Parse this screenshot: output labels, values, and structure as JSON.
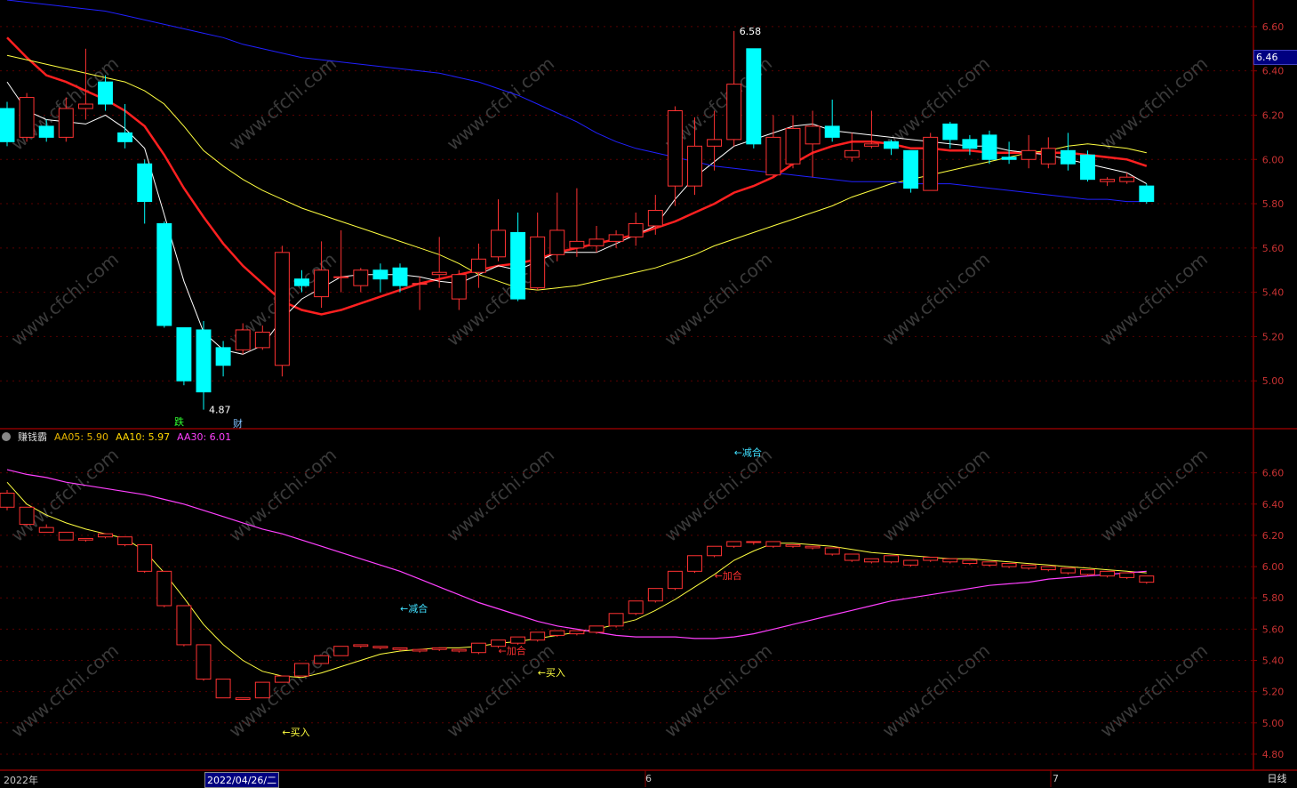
{
  "chart_data": [
    {
      "type": "candlestick",
      "panel": "main",
      "ylim": [
        4.8,
        6.7
      ],
      "y_ticks": [
        "6.60",
        "6.40",
        "6.20",
        "6.00",
        "5.80",
        "5.60",
        "5.40",
        "5.20",
        "5.00"
      ],
      "current_price": "6.46",
      "annotations": {
        "high": "6.58",
        "low": "4.87",
        "marker_down": "跌",
        "marker_fin": "财"
      },
      "candles": [
        [
          6.23,
          6.08,
          6.26,
          6.06
        ],
        [
          6.1,
          6.28,
          6.3,
          6.08
        ],
        [
          6.15,
          6.1,
          6.18,
          6.08
        ],
        [
          6.1,
          6.23,
          6.28,
          6.08
        ],
        [
          6.23,
          6.25,
          6.5,
          6.18
        ],
        [
          6.35,
          6.25,
          6.38,
          6.22
        ],
        [
          6.12,
          6.08,
          6.25,
          6.05
        ],
        [
          5.98,
          5.81,
          6.0,
          5.71
        ],
        [
          5.71,
          5.25,
          5.72,
          5.24
        ],
        [
          5.24,
          5.0,
          5.24,
          4.98
        ],
        [
          5.23,
          4.95,
          5.27,
          4.87
        ],
        [
          5.15,
          5.07,
          5.18,
          5.02
        ],
        [
          5.14,
          5.23,
          5.26,
          5.12
        ],
        [
          5.15,
          5.22,
          5.25,
          5.14
        ],
        [
          5.07,
          5.58,
          5.61,
          5.02
        ],
        [
          5.46,
          5.43,
          5.5,
          5.4
        ],
        [
          5.38,
          5.5,
          5.63,
          5.33
        ],
        [
          5.47,
          5.47,
          5.68,
          5.4
        ],
        [
          5.43,
          5.5,
          5.51,
          5.4
        ],
        [
          5.5,
          5.46,
          5.53,
          5.4
        ],
        [
          5.51,
          5.43,
          5.53,
          5.4
        ],
        [
          5.44,
          5.44,
          5.47,
          5.32
        ],
        [
          5.48,
          5.49,
          5.65,
          5.42
        ],
        [
          5.37,
          5.48,
          5.5,
          5.32
        ],
        [
          5.49,
          5.55,
          5.62,
          5.42
        ],
        [
          5.56,
          5.68,
          5.82,
          5.54
        ],
        [
          5.67,
          5.37,
          5.76,
          5.36
        ],
        [
          5.42,
          5.65,
          5.76,
          5.41
        ],
        [
          5.57,
          5.68,
          5.85,
          5.54
        ],
        [
          5.6,
          5.63,
          5.87,
          5.56
        ],
        [
          5.61,
          5.64,
          5.7,
          5.58
        ],
        [
          5.63,
          5.66,
          5.68,
          5.6
        ],
        [
          5.65,
          5.71,
          5.76,
          5.61
        ],
        [
          5.7,
          5.77,
          5.84,
          5.66
        ],
        [
          5.88,
          6.22,
          6.24,
          5.79
        ],
        [
          5.88,
          6.06,
          6.19,
          5.84
        ],
        [
          6.06,
          6.09,
          6.22,
          5.95
        ],
        [
          6.09,
          6.34,
          6.58,
          6.06
        ],
        [
          6.5,
          6.07,
          6.5,
          6.05
        ],
        [
          5.93,
          6.1,
          6.2,
          5.92
        ],
        [
          5.98,
          6.14,
          6.2,
          5.96
        ],
        [
          6.07,
          6.15,
          6.22,
          5.92
        ],
        [
          6.15,
          6.1,
          6.27,
          6.08
        ],
        [
          6.01,
          6.04,
          6.12,
          5.99
        ],
        [
          6.06,
          6.07,
          6.22,
          6.05
        ],
        [
          6.08,
          6.05,
          6.09,
          6.02
        ],
        [
          6.04,
          5.87,
          6.04,
          5.85
        ],
        [
          5.86,
          6.1,
          6.12,
          5.86
        ],
        [
          6.16,
          6.09,
          6.17,
          6.05
        ],
        [
          6.09,
          6.05,
          6.11,
          6.02
        ],
        [
          6.11,
          6.0,
          6.13,
          5.98
        ],
        [
          6.01,
          6.0,
          6.08,
          5.98
        ],
        [
          6.0,
          6.04,
          6.11,
          5.96
        ],
        [
          5.98,
          6.05,
          6.1,
          5.96
        ],
        [
          6.04,
          5.98,
          6.12,
          5.95
        ],
        [
          6.02,
          5.91,
          6.04,
          5.9
        ],
        [
          5.9,
          5.91,
          5.92,
          5.88
        ],
        [
          5.9,
          5.92,
          5.94,
          5.89
        ],
        [
          5.88,
          5.81,
          5.89,
          5.8
        ]
      ],
      "series": [
        {
          "color": "#ff2020",
          "width": 2.5,
          "values": [
            6.55,
            6.46,
            6.38,
            6.35,
            6.31,
            6.27,
            6.22,
            6.15,
            6.02,
            5.87,
            5.74,
            5.62,
            5.52,
            5.44,
            5.36,
            5.32,
            5.3,
            5.32,
            5.35,
            5.38,
            5.41,
            5.44,
            5.46,
            5.48,
            5.5,
            5.52,
            5.53,
            5.55,
            5.58,
            5.6,
            5.62,
            5.64,
            5.66,
            5.69,
            5.72,
            5.76,
            5.8,
            5.85,
            5.88,
            5.92,
            5.98,
            6.03,
            6.06,
            6.08,
            6.08,
            6.07,
            6.05,
            6.05,
            6.04,
            6.04,
            6.03,
            6.03,
            6.03,
            6.03,
            6.03,
            6.02,
            6.01,
            6.0,
            5.97
          ]
        },
        {
          "color": "#ffffff",
          "width": 1,
          "values": [
            6.35,
            6.22,
            6.18,
            6.17,
            6.16,
            6.2,
            6.14,
            6.05,
            5.75,
            5.45,
            5.22,
            5.14,
            5.12,
            5.16,
            5.28,
            5.37,
            5.42,
            5.47,
            5.48,
            5.48,
            5.48,
            5.47,
            5.45,
            5.44,
            5.48,
            5.52,
            5.5,
            5.54,
            5.58,
            5.58,
            5.58,
            5.62,
            5.66,
            5.7,
            5.82,
            5.92,
            5.99,
            6.06,
            6.09,
            6.12,
            6.15,
            6.16,
            6.13,
            6.12,
            6.11,
            6.1,
            6.09,
            6.08,
            6.07,
            6.06,
            6.06,
            6.04,
            6.03,
            6.02,
            6.0,
            5.98,
            5.96,
            5.94,
            5.89
          ]
        },
        {
          "color": "#ffff40",
          "width": 1,
          "values": [
            6.47,
            6.45,
            6.43,
            6.41,
            6.39,
            6.37,
            6.35,
            6.31,
            6.25,
            6.15,
            6.04,
            5.97,
            5.91,
            5.86,
            5.82,
            5.78,
            5.75,
            5.72,
            5.69,
            5.66,
            5.63,
            5.6,
            5.57,
            5.53,
            5.48,
            5.45,
            5.42,
            5.41,
            5.42,
            5.43,
            5.45,
            5.47,
            5.49,
            5.51,
            5.54,
            5.57,
            5.61,
            5.64,
            5.67,
            5.7,
            5.73,
            5.76,
            5.79,
            5.83,
            5.86,
            5.89,
            5.91,
            5.93,
            5.95,
            5.97,
            5.99,
            6.01,
            6.03,
            6.04,
            6.06,
            6.07,
            6.06,
            6.05,
            6.03
          ]
        },
        {
          "color": "#2020ff",
          "width": 1,
          "values": [
            6.72,
            6.71,
            6.7,
            6.69,
            6.68,
            6.67,
            6.65,
            6.63,
            6.61,
            6.59,
            6.57,
            6.55,
            6.52,
            6.5,
            6.48,
            6.46,
            6.45,
            6.44,
            6.43,
            6.42,
            6.41,
            6.4,
            6.39,
            6.37,
            6.35,
            6.32,
            6.29,
            6.25,
            6.21,
            6.17,
            6.12,
            6.08,
            6.05,
            6.03,
            6.01,
            5.99,
            5.97,
            5.96,
            5.95,
            5.94,
            5.93,
            5.92,
            5.91,
            5.9,
            5.9,
            5.9,
            5.89,
            5.89,
            5.89,
            5.88,
            5.87,
            5.86,
            5.85,
            5.84,
            5.83,
            5.82,
            5.82,
            5.81,
            5.81
          ]
        }
      ]
    },
    {
      "type": "candlestick",
      "panel": "indicator",
      "name": "赚钱霸",
      "legend": [
        {
          "label": "AA05: 5.90",
          "color": "#e6b400"
        },
        {
          "label": "AA10: 5.97",
          "color": "#ffd700"
        },
        {
          "label": "AA30: 6.01",
          "color": "#ff40ff"
        }
      ],
      "ylim": [
        4.72,
        6.78
      ],
      "y_ticks": [
        "6.60",
        "6.40",
        "6.20",
        "6.00",
        "5.80",
        "5.60",
        "5.40",
        "5.20",
        "5.00",
        "4.80"
      ],
      "annotations": [
        {
          "text": "←减合",
          "x_index": 37,
          "y": 6.71,
          "color": "#40e0ff"
        },
        {
          "text": "←减合",
          "x_index": 20,
          "y": 5.71,
          "color": "#40e0ff"
        },
        {
          "text": "←加合",
          "x_index": 25,
          "y": 5.44,
          "color": "#ff3030"
        },
        {
          "text": "←加合",
          "x_index": 36,
          "y": 5.92,
          "color": "#ff3030"
        },
        {
          "text": "←买入",
          "x_index": 27,
          "y": 5.3,
          "color": "#ffff40"
        },
        {
          "text": "←买入",
          "x_index": 14,
          "y": 4.92,
          "color": "#ffff40"
        }
      ],
      "candles": [
        [
          6.38,
          6.47,
          6.49,
          6.36
        ],
        [
          6.27,
          6.38,
          6.38,
          6.26
        ],
        [
          6.22,
          6.25,
          6.27,
          6.22
        ],
        [
          6.17,
          6.22,
          6.22,
          6.17
        ],
        [
          6.17,
          6.18,
          6.18,
          6.16
        ],
        [
          6.19,
          6.21,
          6.21,
          6.18
        ],
        [
          6.14,
          6.19,
          6.19,
          6.13
        ],
        [
          5.97,
          6.14,
          6.14,
          5.96
        ],
        [
          5.75,
          5.97,
          5.97,
          5.74
        ],
        [
          5.5,
          5.75,
          5.75,
          5.49
        ],
        [
          5.28,
          5.5,
          5.5,
          5.27
        ],
        [
          5.16,
          5.28,
          5.28,
          5.16
        ],
        [
          5.15,
          5.16,
          5.16,
          5.15
        ],
        [
          5.16,
          5.26,
          5.26,
          5.16
        ],
        [
          5.26,
          5.3,
          5.3,
          5.26
        ],
        [
          5.3,
          5.38,
          5.38,
          5.3
        ],
        [
          5.38,
          5.43,
          5.43,
          5.38
        ],
        [
          5.43,
          5.49,
          5.49,
          5.43
        ],
        [
          5.49,
          5.5,
          5.5,
          5.48
        ],
        [
          5.48,
          5.49,
          5.49,
          5.47
        ],
        [
          5.47,
          5.48,
          5.48,
          5.46
        ],
        [
          5.46,
          5.47,
          5.47,
          5.45
        ],
        [
          5.47,
          5.48,
          5.48,
          5.46
        ],
        [
          5.46,
          5.47,
          5.47,
          5.45
        ],
        [
          5.45,
          5.51,
          5.51,
          5.44
        ],
        [
          5.49,
          5.53,
          5.53,
          5.48
        ],
        [
          5.51,
          5.55,
          5.55,
          5.5
        ],
        [
          5.53,
          5.58,
          5.58,
          5.52
        ],
        [
          5.56,
          5.59,
          5.59,
          5.55
        ],
        [
          5.57,
          5.59,
          5.59,
          5.56
        ],
        [
          5.58,
          5.62,
          5.62,
          5.57
        ],
        [
          5.62,
          5.7,
          5.7,
          5.61
        ],
        [
          5.7,
          5.78,
          5.78,
          5.69
        ],
        [
          5.78,
          5.86,
          5.86,
          5.77
        ],
        [
          5.86,
          5.97,
          5.97,
          5.85
        ],
        [
          5.97,
          6.07,
          6.07,
          5.96
        ],
        [
          6.07,
          6.13,
          6.13,
          6.06
        ],
        [
          6.13,
          6.16,
          6.16,
          6.12
        ],
        [
          6.16,
          6.16,
          6.16,
          6.14
        ],
        [
          6.13,
          6.16,
          6.16,
          6.12
        ],
        [
          6.13,
          6.14,
          6.14,
          6.12
        ],
        [
          6.12,
          6.13,
          6.13,
          6.11
        ],
        [
          6.08,
          6.12,
          6.12,
          6.07
        ],
        [
          6.04,
          6.08,
          6.08,
          6.03
        ],
        [
          6.03,
          6.05,
          6.05,
          6.02
        ],
        [
          6.03,
          6.07,
          6.07,
          6.02
        ],
        [
          6.01,
          6.04,
          6.04,
          6.0
        ],
        [
          6.04,
          6.06,
          6.06,
          6.03
        ],
        [
          6.03,
          6.05,
          6.05,
          6.02
        ],
        [
          6.02,
          6.04,
          6.04,
          6.01
        ],
        [
          6.01,
          6.03,
          6.03,
          6.0
        ],
        [
          6.0,
          6.02,
          6.02,
          5.99
        ],
        [
          5.99,
          6.01,
          6.01,
          5.98
        ],
        [
          5.98,
          6.0,
          6.0,
          5.97
        ],
        [
          5.96,
          5.99,
          5.99,
          5.95
        ],
        [
          5.95,
          5.98,
          5.98,
          5.94
        ],
        [
          5.94,
          5.97,
          5.97,
          5.93
        ],
        [
          5.93,
          5.96,
          5.96,
          5.92
        ],
        [
          5.9,
          5.94,
          5.94,
          5.89
        ]
      ],
      "series": [
        {
          "color": "#ffff40",
          "width": 1,
          "values": [
            6.54,
            6.4,
            6.33,
            6.28,
            6.24,
            6.21,
            6.18,
            6.1,
            5.96,
            5.8,
            5.63,
            5.5,
            5.4,
            5.33,
            5.3,
            5.29,
            5.32,
            5.36,
            5.4,
            5.44,
            5.46,
            5.47,
            5.48,
            5.48,
            5.49,
            5.51,
            5.52,
            5.54,
            5.56,
            5.58,
            5.6,
            5.63,
            5.66,
            5.72,
            5.79,
            5.87,
            5.95,
            6.04,
            6.1,
            6.15,
            6.15,
            6.14,
            6.13,
            6.11,
            6.09,
            6.08,
            6.07,
            6.06,
            6.05,
            6.05,
            6.04,
            6.03,
            6.02,
            6.01,
            6.0,
            5.99,
            5.98,
            5.97,
            5.96
          ]
        },
        {
          "color": "#ff40ff",
          "width": 1.2,
          "values": [
            6.62,
            6.59,
            6.57,
            6.54,
            6.52,
            6.5,
            6.48,
            6.46,
            6.43,
            6.4,
            6.36,
            6.32,
            6.28,
            6.24,
            6.21,
            6.17,
            6.13,
            6.09,
            6.05,
            6.01,
            5.97,
            5.92,
            5.87,
            5.82,
            5.77,
            5.73,
            5.69,
            5.65,
            5.62,
            5.6,
            5.58,
            5.56,
            5.55,
            5.55,
            5.55,
            5.54,
            5.54,
            5.55,
            5.57,
            5.6,
            5.63,
            5.66,
            5.69,
            5.72,
            5.75,
            5.78,
            5.8,
            5.82,
            5.84,
            5.86,
            5.88,
            5.89,
            5.9,
            5.92,
            5.93,
            5.94,
            5.95,
            5.96,
            5.97
          ]
        }
      ]
    }
  ],
  "time_axis": {
    "label_year": "2022年",
    "cursor_date": "2022/04/26/二",
    "label_june": "6",
    "label_july": "7"
  },
  "period_button": "日线",
  "watermark": "www.cfchi.com",
  "colors": {
    "up": "#ff3232",
    "down": "#00ffff",
    "background": "#000000",
    "frame": "#8b0000"
  }
}
